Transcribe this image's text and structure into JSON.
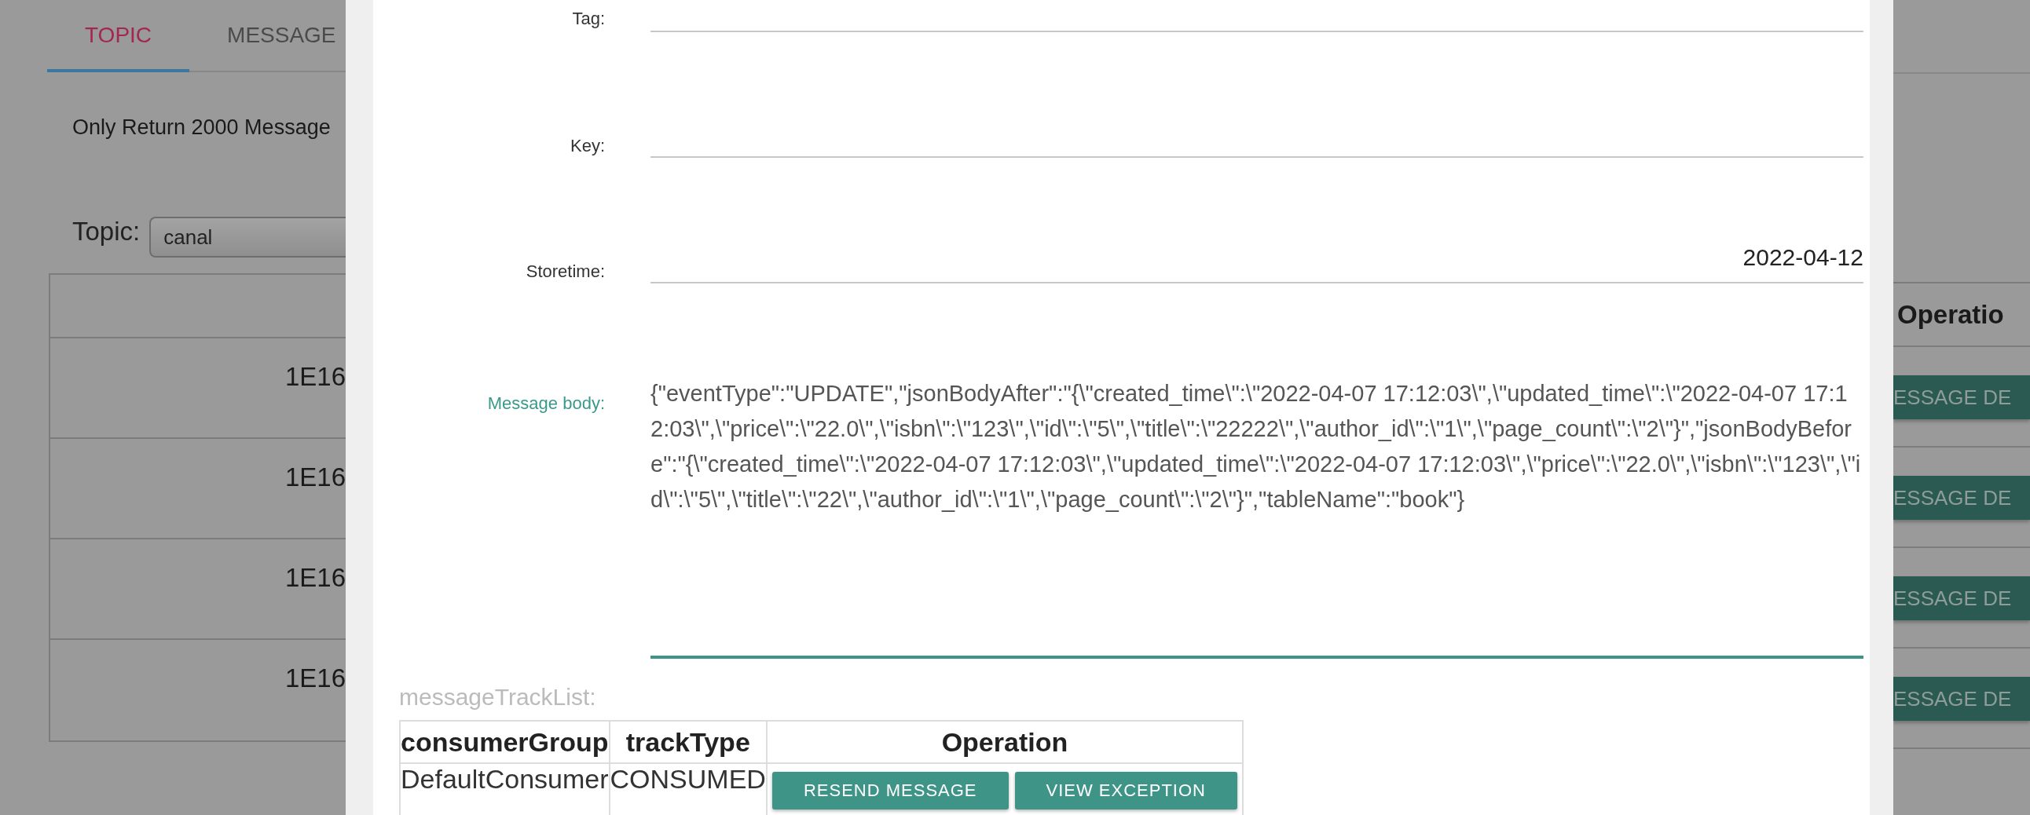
{
  "background_page": {
    "tabs": [
      {
        "label": "TOPIC",
        "selected": true
      },
      {
        "label": "MESSAGE",
        "selected": false
      }
    ],
    "notice": "Only Return 2000 Message",
    "topic_filter": {
      "label": "Topic:",
      "value": "canal"
    },
    "table": {
      "rows": [
        {
          "message_id": "1E16",
          "action": "ESSAGE DE"
        },
        {
          "message_id": "1E16",
          "action": "ESSAGE DE"
        },
        {
          "message_id": "1E16",
          "action": "ESSAGE DE"
        },
        {
          "message_id": "1E16",
          "action": "ESSAGE DE"
        }
      ],
      "operation_header": "Operatio"
    }
  },
  "dialog": {
    "fields": [
      {
        "label": "Tag:"
      },
      {
        "label": "Key:"
      },
      {
        "label": "Storetime:",
        "value": "2022-04-12"
      }
    ],
    "message_body": {
      "label": "Message body:",
      "focused": true,
      "value": "{\"eventType\":\"UPDATE\",\"jsonBodyAfter\":\"{\\\"created_time\\\":\\\"2022-04-07 17:12:03\\\",\\\"updated_time\\\":\\\"2022-04-07 17:12:03\\\",\\\"price\\\":\\\"22.0\\\",\\\"isbn\\\":\\\"123\\\",\\\"id\\\":\\\"5\\\",\\\"title\\\":\\\"22222\\\",\\\"author_id\\\":\\\"1\\\",\\\"page_count\\\":\\\"2\\\"}\",\"jsonBodyBefore\":\"{\\\"created_time\\\":\\\"2022-04-07 17:12:03\\\",\\\"updated_time\\\":\\\"2022-04-07 17:12:03\\\",\\\"price\\\":\\\"22.0\\\",\\\"isbn\\\":\\\"123\\\",\\\"id\\\":\\\"5\\\",\\\"title\\\":\\\"22\\\",\\\"author_id\\\":\\\"1\\\",\\\"page_count\\\":\\\"2\\\"}\",\"tableName\":\"book\"}"
    },
    "track_list": {
      "title": "messageTrackList:",
      "columns": [
        "consumerGroup",
        "trackType",
        "Operation"
      ],
      "rows": [
        {
          "consumer_group": "DefaultConsumer",
          "track_type": "CONSUMED",
          "actions": [
            "RESEND MESSAGE",
            "VIEW EXCEPTION"
          ]
        }
      ]
    }
  }
}
